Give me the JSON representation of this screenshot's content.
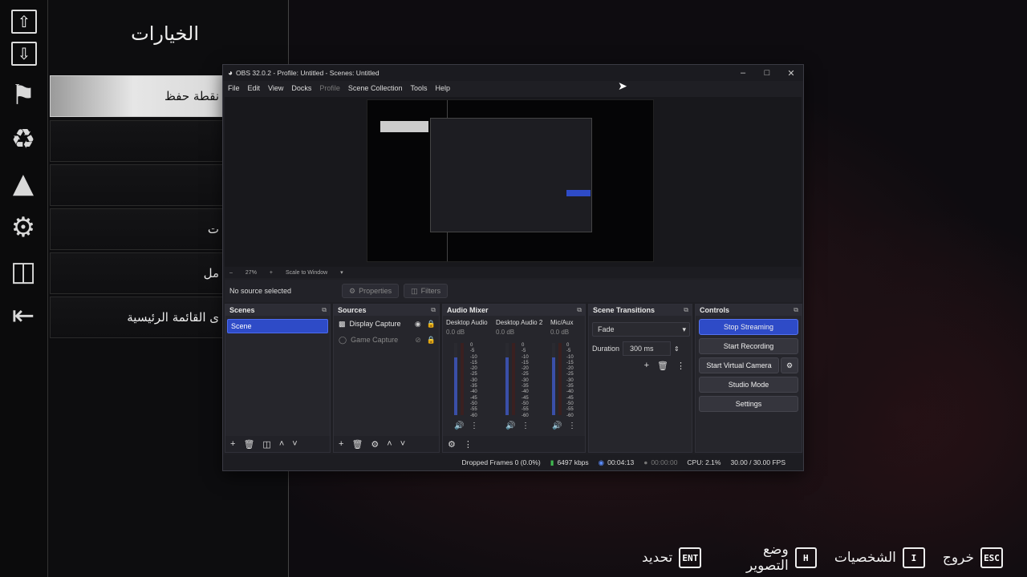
{
  "game": {
    "menu_title": "الخيارات",
    "menu_items": [
      "نقطة حفظ",
      "",
      "",
      "ت",
      "مل",
      "ى القائمة الرئيسية"
    ],
    "bottom_bar": [
      {
        "label": "تحديد",
        "key": "ENT",
        "icon": "enter-key-icon"
      },
      {
        "label": "وضع التصوير",
        "key": "H",
        "icon": "h-key-icon"
      },
      {
        "label": "الشخصيات",
        "key": "I",
        "icon": "i-key-icon"
      },
      {
        "label": "خروج",
        "key": "ESC",
        "icon": "esc-key-icon"
      }
    ],
    "sidebar_icons": [
      "arrow-up-icon",
      "arrow-down-icon",
      "flag-icon",
      "character-icon",
      "map-icon",
      "gear-icon",
      "film-icon",
      "exit-icon"
    ]
  },
  "obs": {
    "title": "OBS 32.0.2 - Profile: Untitled - Scenes: Untitled",
    "menu": [
      "File",
      "Edit",
      "View",
      "Docks",
      "Profile",
      "Scene Collection",
      "Tools",
      "Help"
    ],
    "zoom": "27%",
    "scale_mode": "Scale to Window",
    "no_source": "No source selected",
    "properties_label": "Properties",
    "filters_label": "Filters",
    "docks": {
      "scenes": "Scenes",
      "sources": "Sources",
      "mixer": "Audio Mixer",
      "transitions": "Scene Transitions",
      "controls": "Controls"
    },
    "scene_item": "Scene",
    "sources": [
      {
        "name": "Display Capture",
        "visible": true
      },
      {
        "name": "Game Capture",
        "visible": false
      }
    ],
    "mixer": [
      {
        "name": "Desktop Audio",
        "db": "0.0 dB",
        "level": 0.8
      },
      {
        "name": "Desktop Audio 2",
        "db": "0.0 dB",
        "level": 0.8
      },
      {
        "name": "Mic/Aux",
        "db": "0.0 dB",
        "level": 0.8
      }
    ],
    "meter_scale": [
      "0",
      "-5",
      "-10",
      "-15",
      "-20",
      "-25",
      "-30",
      "-35",
      "-40",
      "-45",
      "-50",
      "-55",
      "-60"
    ],
    "transition": "Fade",
    "duration_label": "Duration",
    "duration": "300 ms",
    "controls": {
      "stop_streaming": "Stop Streaming",
      "start_recording": "Start Recording",
      "start_virtual_camera": "Start Virtual Camera",
      "studio_mode": "Studio Mode",
      "settings": "Settings"
    },
    "status": {
      "dropped": "Dropped Frames 0 (0.0%)",
      "kbps": "6497 kbps",
      "stream_time": "00:04:13",
      "rec_time": "00:00:00",
      "cpu": "CPU: 2.1%",
      "fps": "30.00 / 30.00 FPS"
    }
  }
}
